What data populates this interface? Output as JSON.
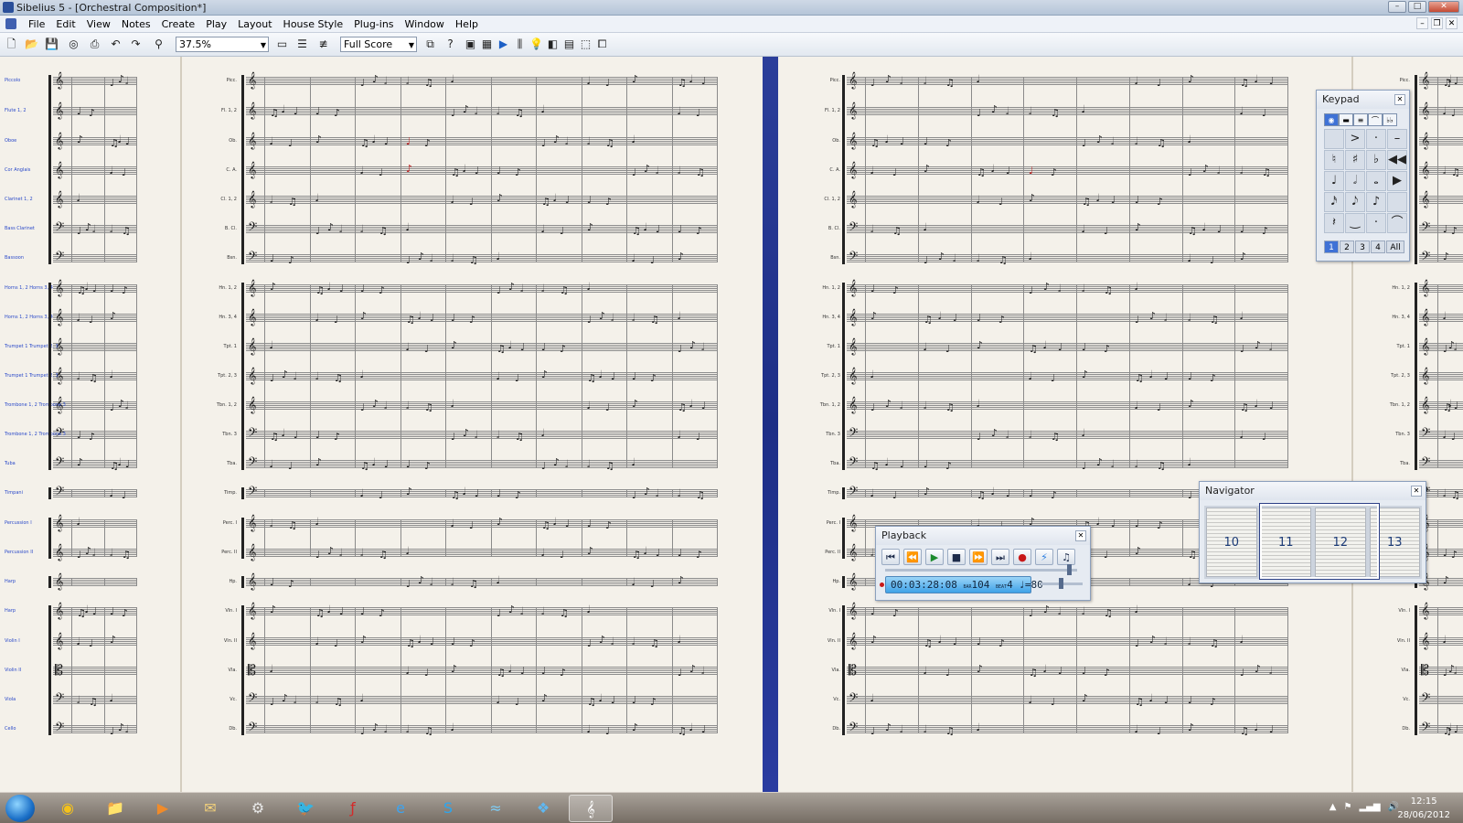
{
  "window": {
    "title": "Sibelius 5 - [Orchestral Composition*]"
  },
  "menu": [
    "File",
    "Edit",
    "View",
    "Notes",
    "Create",
    "Play",
    "Layout",
    "House Style",
    "Plug-ins",
    "Window",
    "Help"
  ],
  "toolbar": {
    "zoom": "37.5%",
    "view_mode": "Full Score"
  },
  "score": {
    "instruments_left_page": [
      "Picc.",
      "Fl. 1, 2",
      "Ob.",
      "C. A.",
      "Cl. 1, 2",
      "B. Cl.",
      "Bsn.",
      "Hn. 1, 2",
      "Hn. 3, 4",
      "Tpt. 1",
      "Tpt. 2, 3",
      "Tbn. 1, 2",
      "Tbn. 3",
      "Tba.",
      "Timp.",
      "Perc. I",
      "Perc. II",
      "Hp.",
      "Vln. I",
      "Vln. II",
      "Vla.",
      "Vc.",
      "Db."
    ],
    "instruments_right_page": [
      "Picc.",
      "Fl. 1, 2",
      "Ob.",
      "C. A.",
      "Cl. 1, 2",
      "B. Cl.",
      "Bsn.",
      "Hn. 1, 2",
      "Hn. 3, 4",
      "Tpt. 1",
      "Tpt. 2, 3",
      "Tbn. 1, 2",
      "Tbn. 3",
      "Tba.",
      "Timp.",
      "Perc. I",
      "Perc. II",
      "Hp.",
      "Vln. I",
      "Vln. II",
      "Vla.",
      "Vc.",
      "Db."
    ],
    "instruments_far_right": [
      "Picc.",
      "Fl. 1, 2",
      "Ob.",
      "C. A.",
      "Cl. 1, 2",
      "B. Cl.",
      "Bsn.",
      "Hn. 1, 2",
      "Hn. 3, 4",
      "Tpt. 1",
      "Tpt. 2, 3",
      "Tbn. 1, 2",
      "Tbn. 3",
      "Tba.",
      "Timp.",
      "Perc. I",
      "Perc. II",
      "Hp.",
      "Vln. I",
      "Vln. II",
      "Vla.",
      "Vc.",
      "Db."
    ],
    "first_page_labels": [
      "Piccolo",
      "Flute 1, 2",
      "Oboe",
      "Cor Anglais",
      "Clarinet 1, 2",
      "Bass Clarinet",
      "Bassoon",
      "Horns 1, 2   Horns 3, 4",
      "Horns 1, 2   Horns 3, 4",
      "Trumpet 1   Trumpet 2, 3",
      "Trumpet 1   Trumpet 2, 3",
      "Trombone 1, 2   Trombone 3",
      "Trombone 1, 2   Trombone 3",
      "Tuba",
      "Timpani",
      "Percussion I",
      "Percussion II",
      "Harp",
      "Harp",
      "Violin I",
      "Violin II",
      "Viola",
      "Cello",
      "Double Bass"
    ]
  },
  "keypad": {
    "title": "Keypad",
    "tabs": [
      "◉",
      "▬",
      "≡",
      "⌒",
      "♭♭"
    ],
    "keys": [
      "",
      ">",
      "·",
      "–",
      "♮",
      "♯",
      "♭",
      "◀◀",
      "♩",
      "𝅗𝅥",
      "𝅝",
      "▶",
      "𝅘𝅥𝅯",
      "𝅘𝅥𝅮",
      "♪",
      "",
      "𝄽",
      "‿",
      "·",
      "⌒"
    ],
    "layers": [
      "1",
      "2",
      "3",
      "4",
      "All"
    ]
  },
  "playback": {
    "title": "Playback",
    "buttons": [
      "⏮",
      "⏪",
      "▶",
      "■",
      "⏩",
      "⏭",
      "●",
      "⚡",
      "♫"
    ],
    "time": "00:03:28:08",
    "bar_label": "BAR",
    "bar": "104",
    "beat_label": "BEAT",
    "beat": "4",
    "tempo": "♩=80"
  },
  "navigator": {
    "title": "Navigator",
    "pages": [
      "10",
      "11",
      "12",
      "13"
    ]
  },
  "taskbar": {
    "apps": [
      "chrome",
      "explorer",
      "media",
      "mail",
      "steam",
      "twitter",
      "flash",
      "ie",
      "skype",
      "wing",
      "dropbox",
      "sibelius"
    ],
    "time": "12:15",
    "date": "28/06/2012"
  }
}
